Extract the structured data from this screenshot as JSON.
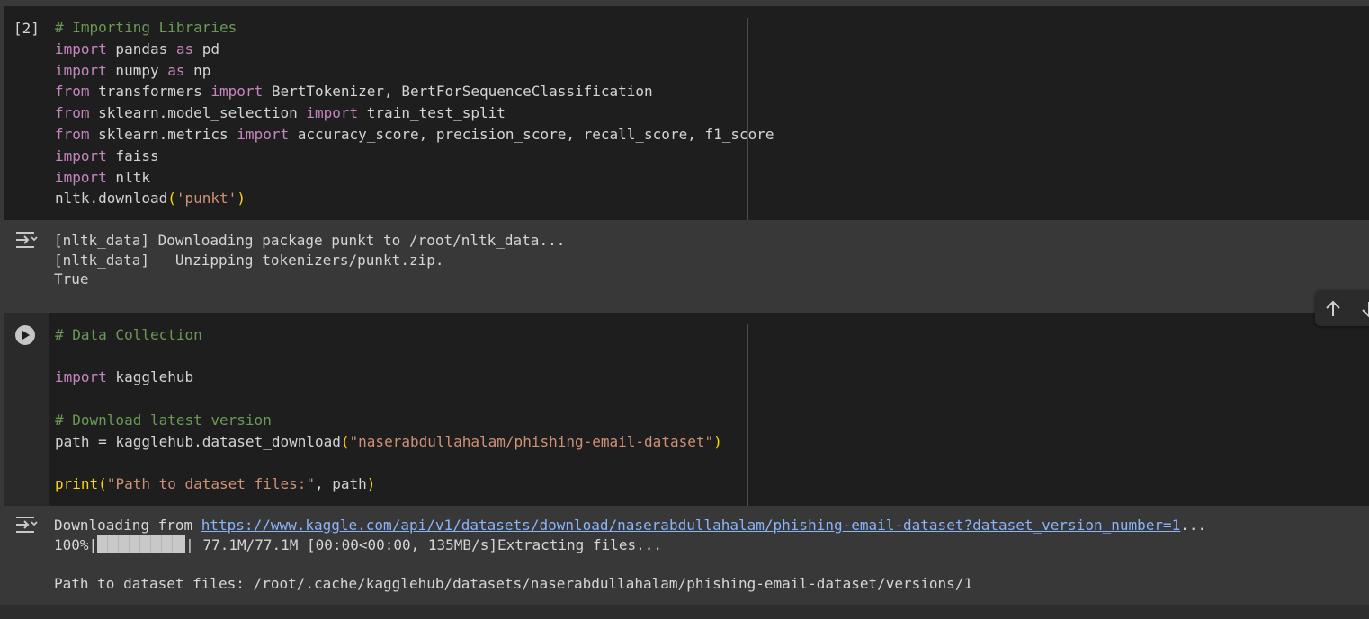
{
  "cell1": {
    "exec_count": "[2]",
    "lines": [
      [
        {
          "t": "# Importing Libraries",
          "c": "cm"
        }
      ],
      [
        {
          "t": "import",
          "c": "kw"
        },
        {
          "t": " pandas "
        },
        {
          "t": "as",
          "c": "kw"
        },
        {
          "t": " pd"
        }
      ],
      [
        {
          "t": "import",
          "c": "kw"
        },
        {
          "t": " numpy "
        },
        {
          "t": "as",
          "c": "kw"
        },
        {
          "t": " np"
        }
      ],
      [
        {
          "t": "from",
          "c": "kw"
        },
        {
          "t": " transformers "
        },
        {
          "t": "import",
          "c": "kw"
        },
        {
          "t": " BertTokenizer, BertForSequenceClassification"
        }
      ],
      [
        {
          "t": "from",
          "c": "kw"
        },
        {
          "t": " sklearn.model_selection "
        },
        {
          "t": "import",
          "c": "kw"
        },
        {
          "t": " train_test_split"
        }
      ],
      [
        {
          "t": "from",
          "c": "kw"
        },
        {
          "t": " sklearn.metrics "
        },
        {
          "t": "import",
          "c": "kw"
        },
        {
          "t": " accuracy_score, precision_score, recall_score, f1_score"
        }
      ],
      [
        {
          "t": "import",
          "c": "kw"
        },
        {
          "t": " faiss"
        }
      ],
      [
        {
          "t": "import",
          "c": "kw"
        },
        {
          "t": " nltk"
        }
      ],
      [
        {
          "t": "nltk.download"
        },
        {
          "t": "(",
          "c": "pn"
        },
        {
          "t": "'punkt'",
          "c": "st"
        },
        {
          "t": ")",
          "c": "pn"
        }
      ]
    ],
    "output_icon": "output-toggle-icon",
    "output": [
      "[nltk_data] Downloading package punkt to /root/nltk_data...",
      "[nltk_data]   Unzipping tokenizers/punkt.zip.",
      "True"
    ]
  },
  "cell2": {
    "run_icon": "play-icon",
    "lines": [
      [
        {
          "t": "# Data Collection",
          "c": "cm"
        }
      ],
      [],
      [
        {
          "t": "import",
          "c": "kw"
        },
        {
          "t": " kagglehub"
        }
      ],
      [],
      [
        {
          "t": "# Download latest version",
          "c": "cm"
        }
      ],
      [
        {
          "t": "path = kagglehub.dataset_download"
        },
        {
          "t": "(",
          "c": "pn"
        },
        {
          "t": "\"naserabdullahalam/phishing-email-dataset\"",
          "c": "st"
        },
        {
          "t": ")",
          "c": "pn"
        }
      ],
      [],
      [
        {
          "t": "print",
          "c": "pn"
        },
        {
          "t": "(",
          "c": "pn"
        },
        {
          "t": "\"Path to dataset files:\"",
          "c": "st"
        },
        {
          "t": ", path"
        },
        {
          "t": ")",
          "c": "pn"
        }
      ]
    ],
    "output_icon": "output-toggle-icon",
    "output": {
      "download_prefix": "Downloading from ",
      "download_url": "https://www.kaggle.com/api/v1/datasets/download/naserabdullahalam/phishing-email-dataset?dataset_version_number=1",
      "download_suffix": "...",
      "progress_percent_text": "100%|",
      "progress_value": 1.0,
      "progress_stats": "| 77.1M/77.1M [00:00<00:00, 135MB/s]Extracting files...",
      "path_line": "Path to dataset files: /root/.cache/kagglehub/datasets/naserabdullahalam/phishing-email-dataset/versions/1"
    }
  },
  "toolbar": {
    "move_up_icon": "arrow-up-icon",
    "move_down_icon": "arrow-down-icon"
  },
  "colors": {
    "keyword": "#c586c0",
    "comment": "#6a9955",
    "string": "#ce9178",
    "bracket": "#ffd700",
    "link": "#8ab4f8"
  }
}
